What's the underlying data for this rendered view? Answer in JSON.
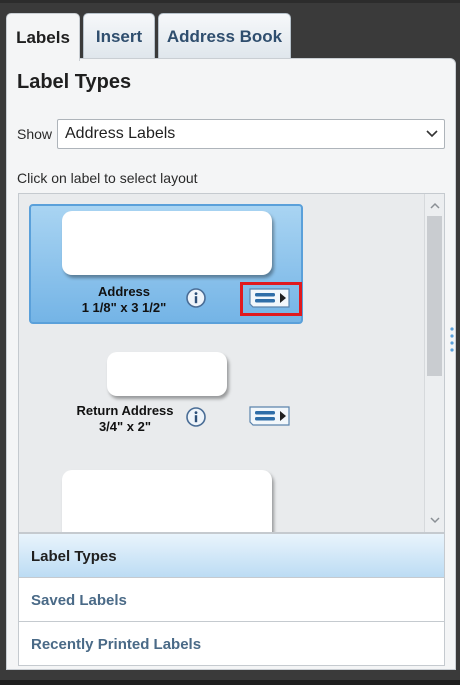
{
  "tabs": [
    {
      "label": "Labels",
      "active": true
    },
    {
      "label": "Insert",
      "active": false
    },
    {
      "label": "Address Book",
      "active": false
    }
  ],
  "panel": {
    "heading": "Label Types",
    "show_label": "Show",
    "show_value": "Address Labels",
    "hint": "Click on label to select layout"
  },
  "labels": [
    {
      "name": "Address",
      "size": "1 1/8\" x 3 1/2\"",
      "selected": true
    },
    {
      "name": "Return Address",
      "size": "3/4\" x 2\"",
      "selected": false
    }
  ],
  "accordion": [
    {
      "label": "Label Types",
      "active": true
    },
    {
      "label": "Saved Labels",
      "active": false
    },
    {
      "label": "Recently Printed Labels",
      "active": false
    }
  ],
  "colors": {
    "accent_blue": "#74b4e6",
    "highlight_red": "#e0191e",
    "tab_text": "#2f4e6e"
  }
}
